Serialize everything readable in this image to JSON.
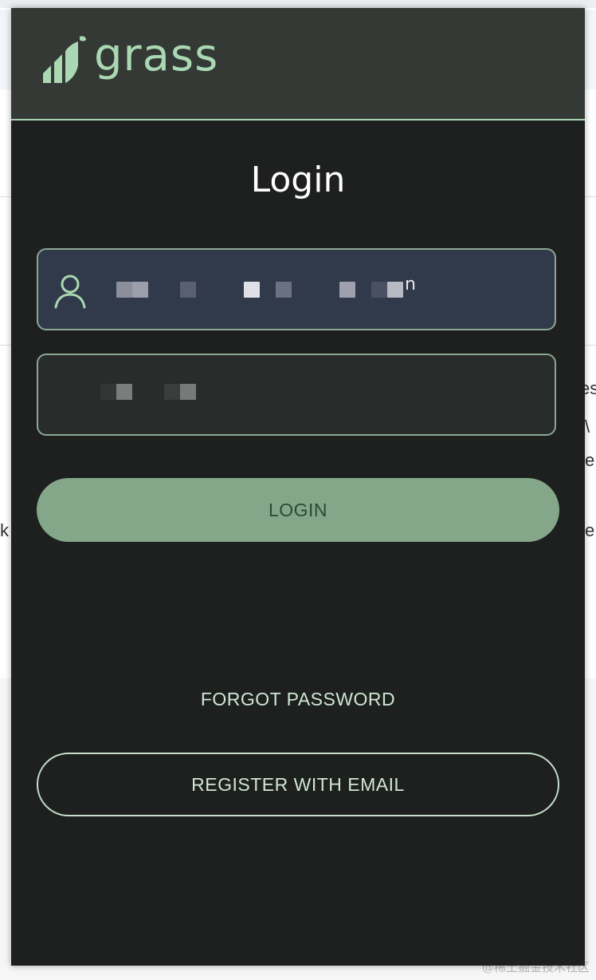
{
  "app": {
    "brand_name": "grass",
    "accent": "#a9d8b2",
    "button_fill": "#84a689"
  },
  "login": {
    "title": "Login",
    "username_value": "n",
    "login_label": "LOGIN",
    "forgot_label": "FORGOT PASSWORD",
    "register_label": "REGISTER WITH EMAIL"
  },
  "background_fragments": [
    "es",
    "\\",
    "e",
    "e",
    "k"
  ],
  "watermark": "@稀土掘金技术社区",
  "icons": {
    "logo": "grass-logo-icon",
    "user": "user-icon"
  }
}
